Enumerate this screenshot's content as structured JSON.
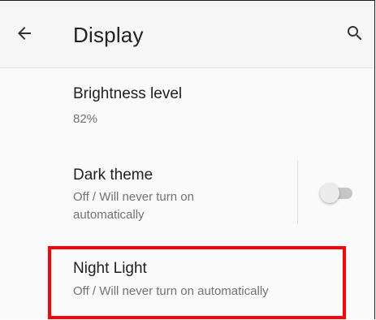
{
  "header": {
    "title": "Display",
    "back_icon": "arrow-back-icon",
    "search_icon": "search-icon"
  },
  "settings": {
    "brightness": {
      "label": "Brightness level",
      "summary": "82%"
    },
    "dark_theme": {
      "label": "Dark theme",
      "summary": "Off / Will never turn on automatically",
      "toggle_on": false
    },
    "night_light": {
      "label": "Night Light",
      "summary": "Off / Will never turn on automatically"
    }
  },
  "highlight_color": "#ff0000"
}
